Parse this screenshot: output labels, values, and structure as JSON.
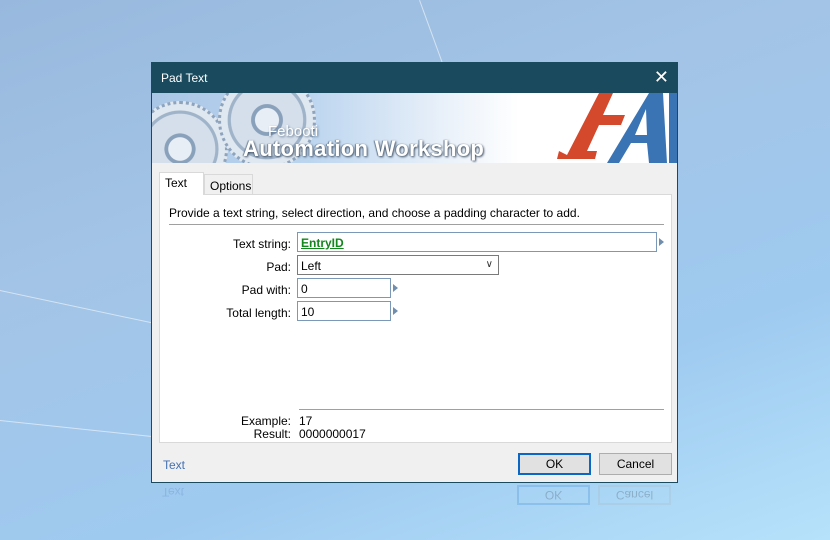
{
  "window": {
    "title": "Pad Text",
    "close_label": "✕"
  },
  "banner": {
    "brand_small": "Febooti",
    "brand_big": "Automation Workshop",
    "colors": {
      "logo_red": "#d4482c",
      "logo_blue": "#3a74b4"
    }
  },
  "tabs": [
    {
      "label": "Text",
      "active": true
    },
    {
      "label": "Options",
      "active": false
    }
  ],
  "panel": {
    "description": "Provide a text string, select direction, and choose a padding character to add.",
    "fields": {
      "text_string": {
        "label": "Text string:",
        "value": "EntryID"
      },
      "pad": {
        "label": "Pad:",
        "value": "Left"
      },
      "pad_with": {
        "label": "Pad with:",
        "value": "0"
      },
      "total_length": {
        "label": "Total length:",
        "value": "10"
      }
    },
    "example": {
      "label": "Example:",
      "value": "17"
    },
    "result": {
      "label": "Result:",
      "value": "0000000017"
    }
  },
  "footer": {
    "help_link": "Text",
    "ok_label": "OK",
    "cancel_label": "Cancel"
  }
}
